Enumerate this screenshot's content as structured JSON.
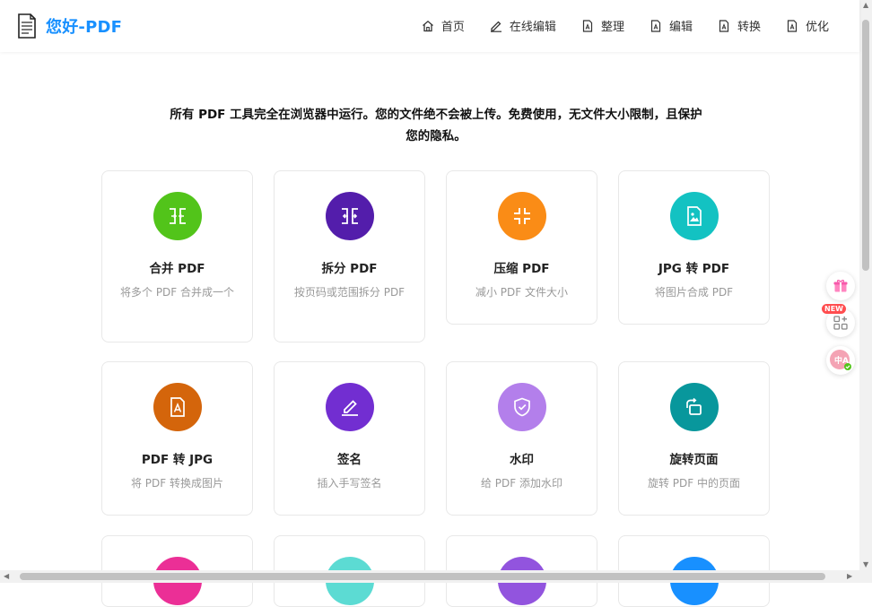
{
  "header": {
    "brand": "您好-PDF",
    "nav": [
      {
        "label": "首页",
        "icon": "home-icon"
      },
      {
        "label": "在线编辑",
        "icon": "pen-icon"
      },
      {
        "label": "整理",
        "icon": "pdf-file-icon"
      },
      {
        "label": "编辑",
        "icon": "pdf-file-icon"
      },
      {
        "label": "转换",
        "icon": "pdf-file-icon"
      },
      {
        "label": "优化",
        "icon": "pdf-file-icon"
      }
    ]
  },
  "intro": {
    "line1": "所有 PDF 工具完全在浏览器中运行。您的文件绝不会被上传。免费使用，无文件大小限制，且保护",
    "line2": "您的隐私。"
  },
  "tools": [
    {
      "title": "合并 PDF",
      "desc": "将多个 PDF 合并成一个",
      "color": "#52c41a",
      "icon": "merge-icon"
    },
    {
      "title": "拆分 PDF",
      "desc": "按页码或范围拆分 PDF",
      "color": "#531dab",
      "icon": "split-icon"
    },
    {
      "title": "压缩 PDF",
      "desc": "减小 PDF 文件大小",
      "color": "#fa8c16",
      "icon": "compress-icon"
    },
    {
      "title": "JPG 转 PDF",
      "desc": "将图片合成 PDF",
      "color": "#13c2c2",
      "icon": "image-file-icon"
    },
    {
      "title": "PDF 转 JPG",
      "desc": "将 PDF 转换成图片",
      "color": "#d4650b",
      "icon": "pdf-file-icon"
    },
    {
      "title": "签名",
      "desc": "插入手写签名",
      "color": "#722ed1",
      "icon": "signature-pen-icon"
    },
    {
      "title": "水印",
      "desc": "给 PDF 添加水印",
      "color": "#b37feb",
      "icon": "shield-check-icon"
    },
    {
      "title": "旋转页面",
      "desc": "旋转 PDF 中的页面",
      "color": "#08979c",
      "icon": "rotate-icon"
    }
  ],
  "more_tool_colors": [
    "#eb2f96",
    "#5cdbd3",
    "#9254de",
    "#1890ff"
  ],
  "float": {
    "new_badge": "NEW"
  }
}
